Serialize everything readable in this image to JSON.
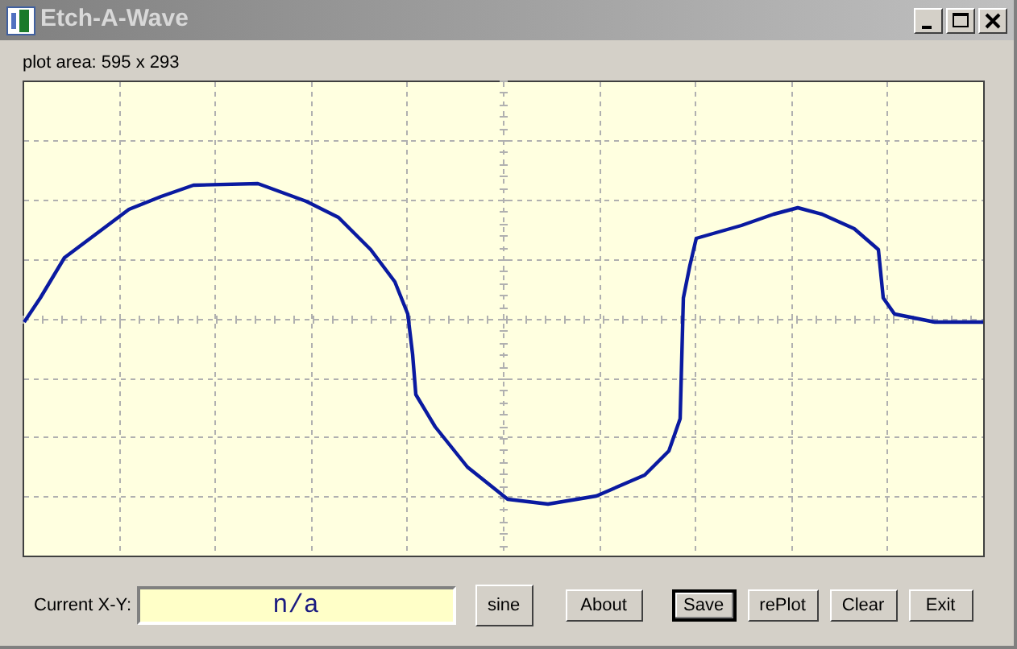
{
  "window": {
    "title": "Etch-A-Wave",
    "controls": [
      {
        "kind": "minimize"
      },
      {
        "kind": "maximize"
      },
      {
        "kind": "close"
      }
    ]
  },
  "plot_label": "plot area: 595 x 293",
  "readout": {
    "label": "Current X-Y:",
    "value": "n/a"
  },
  "buttons": [
    {
      "label": "sine",
      "focused": false
    },
    {
      "label": "About",
      "focused": false
    },
    {
      "label": "Save",
      "focused": true
    },
    {
      "label": "rePlot",
      "focused": false
    },
    {
      "label": "Clear",
      "focused": false
    },
    {
      "label": "Exit",
      "focused": false
    }
  ]
}
